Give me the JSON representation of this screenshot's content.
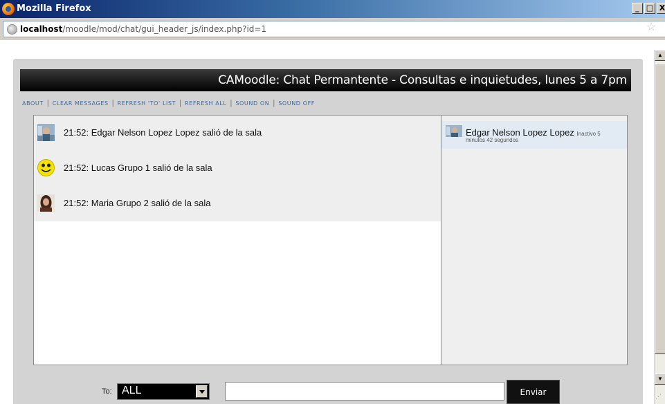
{
  "window": {
    "title": "Mozilla Firefox",
    "url_host": "localhost",
    "url_path": "/moodle/mod/chat/gui_header_js/index.php?id=1",
    "buttons": {
      "minimize": "_",
      "maximize": "□",
      "close": "X"
    }
  },
  "chat": {
    "title": "CAMoodle: Chat Permantente - Consultas e inquietudes, lunes 5 a 7pm",
    "nav": [
      "ABOUT",
      "CLEAR MESSAGES",
      "REFRESH 'TO' LIST",
      "REFRESH ALL",
      "SOUND ON",
      "SOUND OFF"
    ],
    "messages": [
      {
        "text": "21:52: Edgar Nelson Lopez Lopez salió de la sala",
        "avatar": "man-photo"
      },
      {
        "text": "21:52: Lucas Grupo 1 salió de la sala",
        "avatar": "smiley"
      },
      {
        "text": "21:52: Maria Grupo 2 salió de la sala",
        "avatar": "woman-photo"
      }
    ],
    "users": [
      {
        "name": "Edgar Nelson Lopez Lopez",
        "status_line1": "Inactivo 5",
        "status_line2": "minutos 42 segundos",
        "avatar": "man-photo"
      }
    ],
    "form": {
      "to_label": "To:",
      "to_value": "ALL",
      "message_value": "",
      "send_label": "Enviar"
    }
  },
  "colors": {
    "header_bg": "#000000",
    "link": "#3c6aa0",
    "message_bg": "#eeeeee",
    "user_row_bg": "#e2eaf3"
  }
}
